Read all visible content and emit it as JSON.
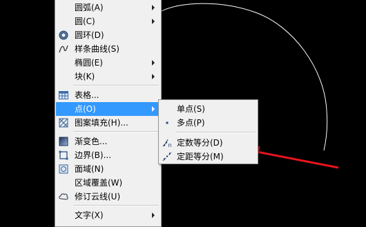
{
  "main_menu": {
    "items": [
      {
        "label": "圆弧(A)",
        "icon": "none",
        "submenu": true
      },
      {
        "label": "圆(C)",
        "icon": "none",
        "submenu": true
      },
      {
        "label": "圆环(D)",
        "icon": "donut-icon",
        "submenu": false
      },
      {
        "label": "样条曲线(S)",
        "icon": "spline-icon",
        "submenu": false
      },
      {
        "label": "椭圆(E)",
        "icon": "none",
        "submenu": true
      },
      {
        "label": "块(K)",
        "icon": "none",
        "submenu": true
      },
      {
        "label": "表格...",
        "icon": "table-icon",
        "submenu": false
      },
      {
        "label": "点(O)",
        "icon": "none",
        "submenu": true,
        "highlighted": true
      },
      {
        "label": "图案填充(H)...",
        "icon": "hatch-icon",
        "submenu": false
      },
      {
        "label": "渐变色...",
        "icon": "gradient-icon",
        "submenu": false
      },
      {
        "label": "边界(B)...",
        "icon": "boundary-icon",
        "submenu": false
      },
      {
        "label": "面域(N)",
        "icon": "region-icon",
        "submenu": false
      },
      {
        "label": "区域覆盖(W)",
        "icon": "none",
        "submenu": false
      },
      {
        "label": "修订云线(U)",
        "icon": "revcloud-icon",
        "submenu": false
      },
      {
        "label": "文字(X)",
        "icon": "none",
        "submenu": true
      }
    ]
  },
  "point_submenu": {
    "items": [
      {
        "label": "单点(S)",
        "icon": "none"
      },
      {
        "label": "多点(P)",
        "icon": "multiple-points-icon"
      },
      {
        "label": "定数等分(D)",
        "icon": "divide-icon"
      },
      {
        "label": "定距等分(M)",
        "icon": "measure-icon"
      }
    ]
  },
  "colors": {
    "background": "#000000",
    "menu_bg": "#f0f0f0",
    "highlight": "#3399ff",
    "arrow": "#e8141e",
    "arc": "#ffffff"
  }
}
